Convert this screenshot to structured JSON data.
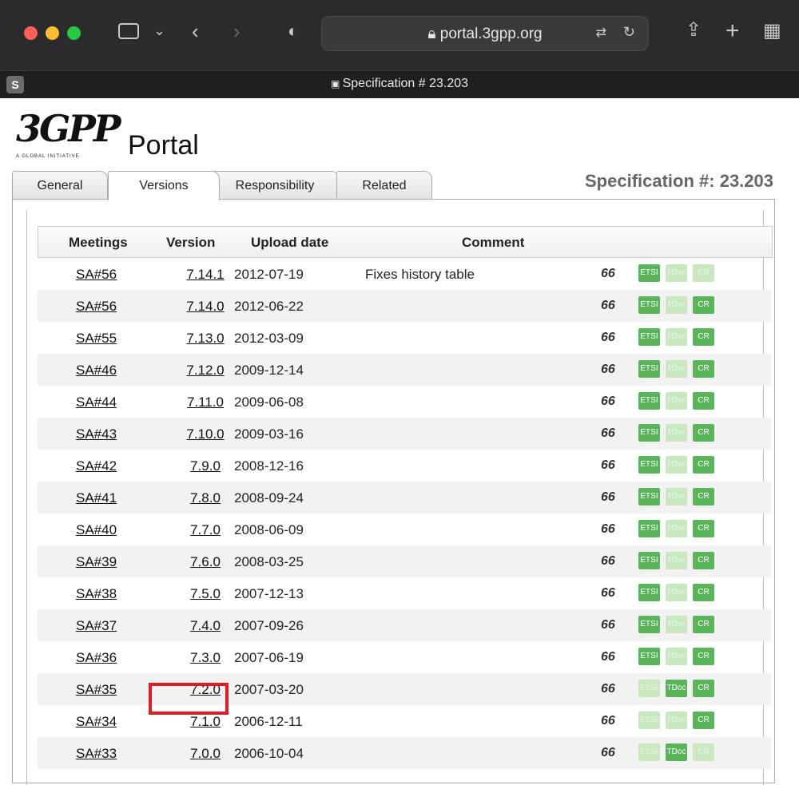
{
  "browser": {
    "url": "portal.3gpp.org",
    "tab_title": "Specification # 23.203",
    "profile_badge": "S",
    "colors": {
      "chrome": "#2b2b2d",
      "tabbar": "#1f1f21"
    }
  },
  "header": {
    "logo_text": "3GPP",
    "logo_tagline": "A GLOBAL INITIATIVE",
    "portal_text": "Portal",
    "spec_heading": "Specification #: 23.203"
  },
  "tabs": [
    {
      "label": "General"
    },
    {
      "label": "Versions"
    },
    {
      "label": "Responsibility"
    },
    {
      "label": "Related"
    }
  ],
  "table": {
    "headers": {
      "meetings": "Meetings",
      "version": "Version",
      "upload_date": "Upload date",
      "comment": "Comment"
    },
    "badge_labels": {
      "etsi": "ETSI",
      "tdoc": "TDoc",
      "cr": "CR"
    },
    "rows": [
      {
        "meeting": "SA#56",
        "version": "7.14.1",
        "date": "2012-07-19",
        "comment": "Fixes history table",
        "etsi": true,
        "tdoc": false,
        "cr": false
      },
      {
        "meeting": "SA#56",
        "version": "7.14.0",
        "date": "2012-06-22",
        "comment": "",
        "etsi": true,
        "tdoc": false,
        "cr": true
      },
      {
        "meeting": "SA#55",
        "version": "7.13.0",
        "date": "2012-03-09",
        "comment": "",
        "etsi": true,
        "tdoc": false,
        "cr": true
      },
      {
        "meeting": "SA#46",
        "version": "7.12.0",
        "date": "2009-12-14",
        "comment": "",
        "etsi": true,
        "tdoc": false,
        "cr": true
      },
      {
        "meeting": "SA#44",
        "version": "7.11.0",
        "date": "2009-06-08",
        "comment": "",
        "etsi": true,
        "tdoc": false,
        "cr": true
      },
      {
        "meeting": "SA#43",
        "version": "7.10.0",
        "date": "2009-03-16",
        "comment": "",
        "etsi": true,
        "tdoc": false,
        "cr": true
      },
      {
        "meeting": "SA#42",
        "version": "7.9.0",
        "date": "2008-12-16",
        "comment": "",
        "etsi": true,
        "tdoc": false,
        "cr": true
      },
      {
        "meeting": "SA#41",
        "version": "7.8.0",
        "date": "2008-09-24",
        "comment": "",
        "etsi": true,
        "tdoc": false,
        "cr": true
      },
      {
        "meeting": "SA#40",
        "version": "7.7.0",
        "date": "2008-06-09",
        "comment": "",
        "etsi": true,
        "tdoc": false,
        "cr": true
      },
      {
        "meeting": "SA#39",
        "version": "7.6.0",
        "date": "2008-03-25",
        "comment": "",
        "etsi": true,
        "tdoc": false,
        "cr": true
      },
      {
        "meeting": "SA#38",
        "version": "7.5.0",
        "date": "2007-12-13",
        "comment": "",
        "etsi": true,
        "tdoc": false,
        "cr": true
      },
      {
        "meeting": "SA#37",
        "version": "7.4.0",
        "date": "2007-09-26",
        "comment": "",
        "etsi": true,
        "tdoc": false,
        "cr": true
      },
      {
        "meeting": "SA#36",
        "version": "7.3.0",
        "date": "2007-06-19",
        "comment": "",
        "etsi": true,
        "tdoc": false,
        "cr": true
      },
      {
        "meeting": "SA#35",
        "version": "7.2.0",
        "date": "2007-03-20",
        "comment": "",
        "etsi": false,
        "tdoc": true,
        "cr": true
      },
      {
        "meeting": "SA#34",
        "version": "7.1.0",
        "date": "2006-12-11",
        "comment": "",
        "etsi": false,
        "tdoc": false,
        "cr": true
      },
      {
        "meeting": "SA#33",
        "version": "7.0.0",
        "date": "2006-10-04",
        "comment": "",
        "etsi": false,
        "tdoc": true,
        "cr": false
      }
    ]
  }
}
